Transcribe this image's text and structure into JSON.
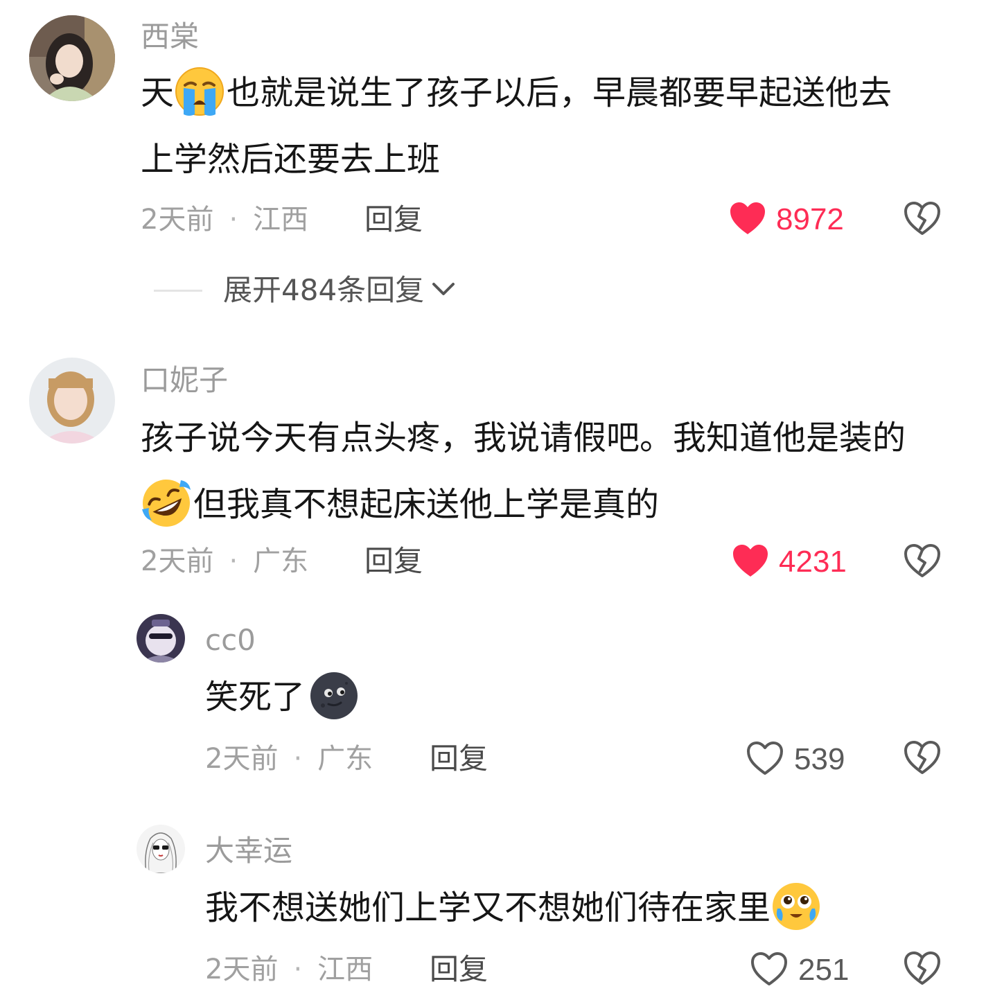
{
  "colors": {
    "liked": "#fe2c55",
    "username": "#9b9b9b",
    "meta": "#a0a0a0",
    "body_text": "#161616"
  },
  "comments": [
    {
      "username": "西棠",
      "lines": [
        "天",
        "也就是说生了孩子以后，早晨都要早起送他去",
        "上学然后还要去上班"
      ],
      "emoji": "loudly-crying-face-icon",
      "time": "2天前",
      "location": "江西",
      "reply_label": "回复",
      "likes": "8972",
      "liked": true,
      "expand_label": "展开484条回复"
    },
    {
      "username": "口妮子",
      "lines": [
        "孩子说今天有点头疼，我说请假吧。我知道他是装的",
        "但我真不想起床送他上学是真的"
      ],
      "emoji": "rolling-on-floor-laughing-icon",
      "time": "2天前",
      "location": "广东",
      "reply_label": "回复",
      "likes": "4231",
      "liked": true,
      "replies": [
        {
          "username": "cc0",
          "text": "笑死了",
          "emoji": "new-moon-face-icon",
          "time": "2天前",
          "location": "广东",
          "reply_label": "回复",
          "likes": "539",
          "liked": false
        },
        {
          "username": "大幸运",
          "text": "我不想送她们上学又不想她们待在家里",
          "emoji": "pleading-face-tears-icon",
          "time": "2天前",
          "location": "江西",
          "reply_label": "回复",
          "likes": "251",
          "liked": false
        }
      ]
    }
  ]
}
